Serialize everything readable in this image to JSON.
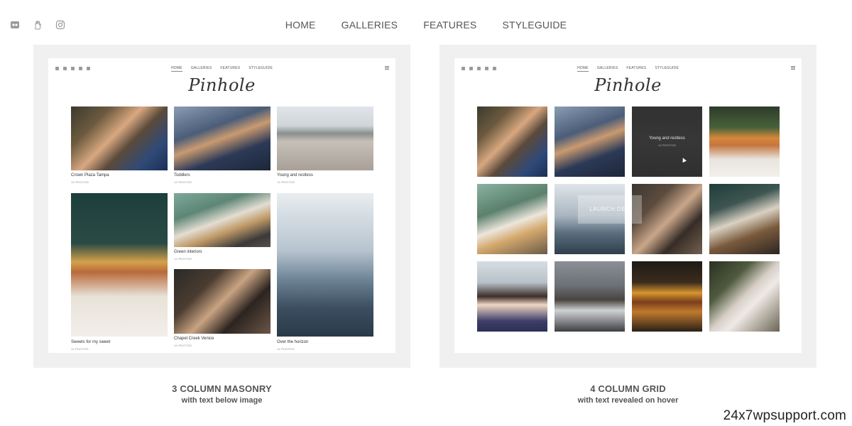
{
  "topbar": {
    "social_icons": [
      "flickr-icon",
      "hand-icon",
      "instagram-icon"
    ],
    "nav": [
      "HOME",
      "GALLERIES",
      "FEATURES",
      "STYLEGUIDE"
    ]
  },
  "mockup": {
    "logo": "Pinhole",
    "mini_nav": [
      "HOME",
      "GALLERIES",
      "FEATURES",
      "STYLEGUIDE"
    ]
  },
  "masonry": {
    "items": [
      {
        "title": "Crown Plaza Tampa",
        "count": "15 PHOTOS"
      },
      {
        "title": "Toddlers",
        "count": "12 PHOTOS"
      },
      {
        "title": "Young and restless",
        "count": "12 PHOTOS"
      },
      {
        "title": "Green interiors",
        "count": "12 PHOTOS"
      },
      {
        "title": "Sweets for my sweet",
        "count": "11 PHOTOS"
      },
      {
        "title": "Chapel Creek Venice",
        "count": "14 PHOTOS"
      },
      {
        "title": "Over the horizon",
        "count": "11 PHOTOS"
      }
    ],
    "heading": "3 COLUMN MASONRY",
    "subheading": "with text below image"
  },
  "grid": {
    "hover_item": {
      "title": "Young and restless",
      "count": "12 PHOTOS"
    },
    "watermark": "LAUNCH.DEN",
    "heading": "4 COLUMN GRID",
    "subheading": "with text revealed on hover"
  },
  "brand": "24x7wpsupport.com",
  "colors": {
    "panel_bg": "#f0f0f0",
    "text": "#555555"
  }
}
